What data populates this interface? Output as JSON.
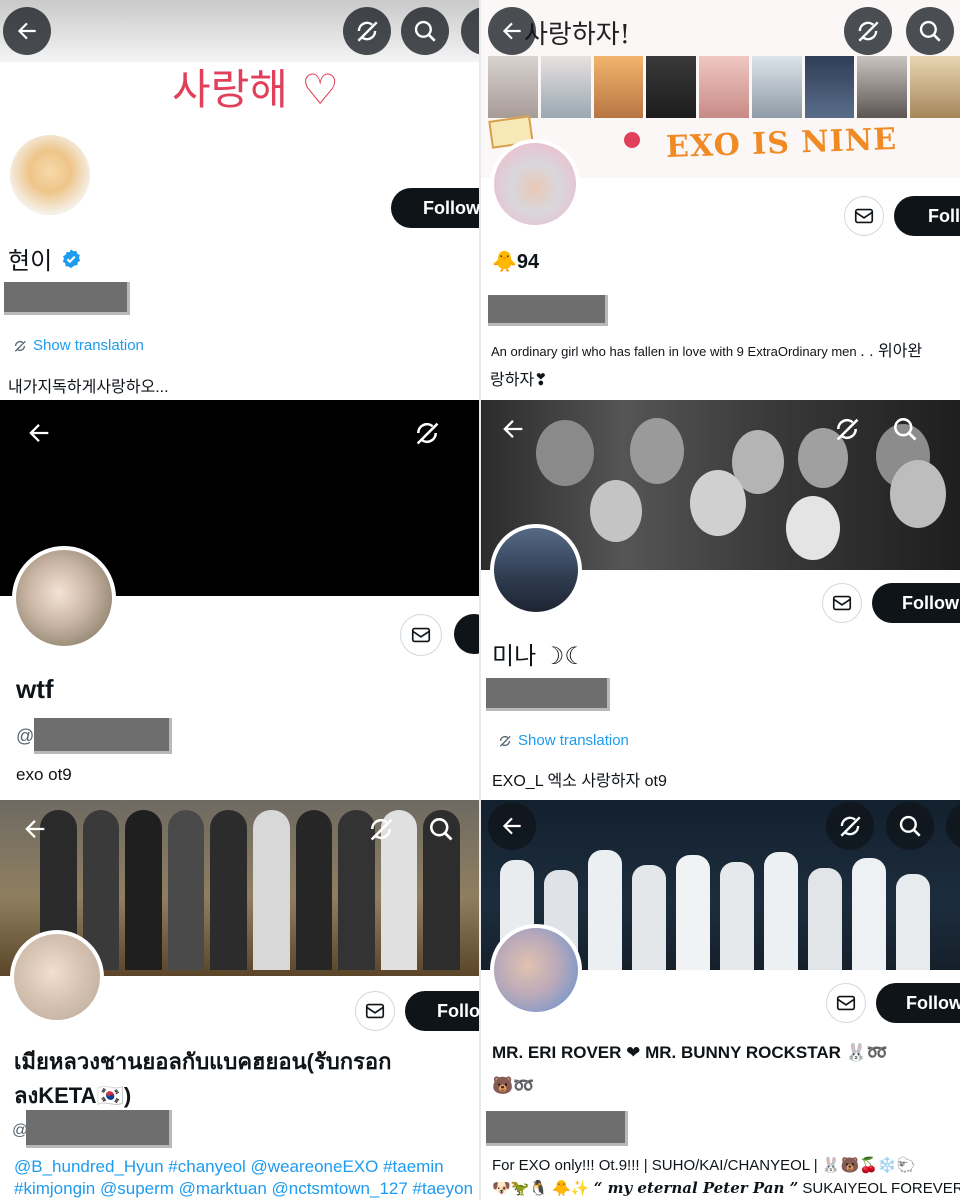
{
  "ui": {
    "follow_label": "Follow",
    "follow_partial_label": "Follo",
    "show_translation": "Show translation",
    "at_symbol": "@"
  },
  "icons": {
    "back": "back-arrow-icon",
    "sync": "sync-off-icon",
    "search": "search-icon",
    "mail": "mail-icon",
    "verified": "verified-badge-icon"
  },
  "colors": {
    "link": "#1d9bf0",
    "follow_bg": "#0f1419",
    "verified": "#1d9bf0",
    "banner_text_red": "#e0405a",
    "banner_text_orange": "#f08a24"
  },
  "profiles": [
    {
      "banner_text": "사랑해 ♡",
      "display_name": "현이",
      "verified": true,
      "bio": "내가지독하게사랑하오..."
    },
    {
      "banner_text_top": "사랑하자!",
      "banner_text_main": "EXO IS NINE",
      "display_name": "🐥94",
      "bio_line1": "An ordinary girl who has fallen in love with 9 ExtraOrdinary men",
      "bio_line1_suffix": ". . 위아완",
      "bio_line2": "랑하자❣"
    },
    {
      "display_name": "wtf",
      "bio": "exo ot9"
    },
    {
      "display_name": "미나 ☽☾",
      "bio": "EXO_L  엑소 사랑하자  ot9"
    },
    {
      "display_name_line1": "เมียหลวงชานยอลกับแบคฮยอน(รับกรอก",
      "display_name_line2": "ลงKETA🇰🇷)",
      "bio_line1": "@B_hundred_Hyun #chanyeol @weareoneEXO #taemin",
      "bio_line2": "#kimjongin @superm @marktuan @nctsmtown_127 #taeyon"
    },
    {
      "display_name_line1": "MR. ERI ROVER ❤ MR. BUNNY ROCKSTAR 🐰➿",
      "display_name_line2": "🐻➿",
      "bio_line1": "For EXO only!!! Ot.9!!! | SUHO/KAI/CHANYEOL | 🐰🐻🍒❄️🐑",
      "bio_line2_emoji": "🐶🦖🐧 🐥✨",
      "bio_line2_quote": "“ my eternal Peter Pan ”",
      "bio_line2_suffix": "SUKAIYEOL FOREVER 💖"
    }
  ]
}
